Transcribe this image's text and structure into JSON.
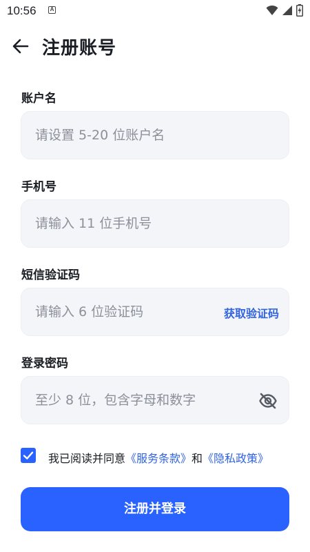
{
  "status_bar": {
    "time": "10:56",
    "notification_letter": "A",
    "icons": [
      "wifi-icon",
      "cell-signal-icon",
      "battery-charging-icon"
    ]
  },
  "header": {
    "back_icon": "arrow-left-icon",
    "title": "注册账号"
  },
  "form": {
    "username": {
      "label": "账户名",
      "value": "",
      "placeholder": "请设置 5-20 位账户名"
    },
    "phone": {
      "label": "手机号",
      "value": "",
      "placeholder": "请输入 11 位手机号"
    },
    "sms_code": {
      "label": "短信验证码",
      "value": "",
      "placeholder": "请输入 6 位验证码",
      "action_label": "获取验证码"
    },
    "password": {
      "label": "登录密码",
      "value": "",
      "placeholder": "至少 8 位，包含字母和数字",
      "visibility_icon": "eye-off-icon"
    }
  },
  "agreement": {
    "checked": true,
    "text_before": "我已阅读并同意",
    "terms_link": "《服务条款》",
    "and_text": "和",
    "privacy_link": "《隐私政策》"
  },
  "submit_label": "注册并登录",
  "colors": {
    "accent": "#2962ff",
    "link": "#2f63e0",
    "field_bg": "#f4f5f8",
    "placeholder": "#8b909a",
    "text": "#1a1d23"
  }
}
